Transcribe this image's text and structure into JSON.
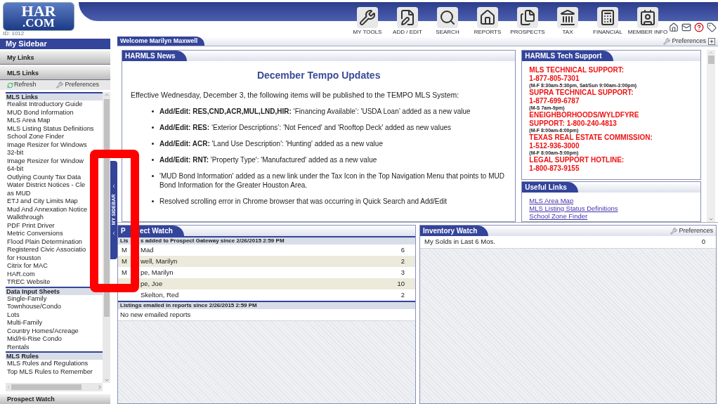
{
  "header": {
    "logo_top": "HAR",
    "logo_bottom": ".COM",
    "id_text": "ID: 1012",
    "nav": [
      {
        "label": "MY TOOLS"
      },
      {
        "label": "ADD / EDIT"
      },
      {
        "label": "SEARCH"
      },
      {
        "label": "REPORTS"
      },
      {
        "label": "PROSPECTS"
      },
      {
        "label": "TAX"
      },
      {
        "label": "FINANCIAL"
      },
      {
        "label": "MEMBER INFO"
      }
    ]
  },
  "sidebar": {
    "title": "My Sidebar",
    "sections": [
      "My Links",
      "MLS Links"
    ],
    "refresh": "Refresh",
    "preferences": "Preferences",
    "items": [
      {
        "kind": "heading",
        "text": "MLS Links"
      },
      {
        "kind": "link",
        "text": "Realist Introductory Guide"
      },
      {
        "kind": "link",
        "text": "MUD Bond Information"
      },
      {
        "kind": "link",
        "text": "MLS Area Map"
      },
      {
        "kind": "link",
        "text": "MLS Listing Status Definitions"
      },
      {
        "kind": "link",
        "text": "School Zone Finder"
      },
      {
        "kind": "link",
        "text": "Image Resizer for Windows"
      },
      {
        "kind": "link",
        "text": "32-bit"
      },
      {
        "kind": "link",
        "text": "Image Resizer for Window"
      },
      {
        "kind": "link",
        "text": "64-bit"
      },
      {
        "kind": "link",
        "text": "Outlying County Tax Data"
      },
      {
        "kind": "link",
        "text": "Water District Notices - Cle"
      },
      {
        "kind": "link",
        "text": "as MUD"
      },
      {
        "kind": "link",
        "text": "ETJ and City Limits Map"
      },
      {
        "kind": "link",
        "text": "Mud And Annexation Notice"
      },
      {
        "kind": "link",
        "text": "Walkthrough"
      },
      {
        "kind": "link",
        "text": "PDF Print Driver"
      },
      {
        "kind": "link",
        "text": "Metric Conversions"
      },
      {
        "kind": "link",
        "text": "Flood Plain Determination"
      },
      {
        "kind": "link",
        "text": "Registered Civic Associatio"
      },
      {
        "kind": "link",
        "text": "for Houston"
      },
      {
        "kind": "link",
        "text": "Citrix for MAC"
      },
      {
        "kind": "link",
        "text": "HAR.com"
      },
      {
        "kind": "link",
        "text": "TREC Website"
      },
      {
        "kind": "heading",
        "text": "Data Input Sheets"
      },
      {
        "kind": "link",
        "text": "Single-Family"
      },
      {
        "kind": "link",
        "text": "Townhouse/Condo"
      },
      {
        "kind": "link",
        "text": "Lots"
      },
      {
        "kind": "link",
        "text": "Multi-Family"
      },
      {
        "kind": "link",
        "text": "Country Homes/Acreage"
      },
      {
        "kind": "link",
        "text": "Mid/Hi-Rise Condo"
      },
      {
        "kind": "link",
        "text": "Rentals"
      },
      {
        "kind": "heading",
        "text": "MLS Rules"
      },
      {
        "kind": "link",
        "text": "MLS Rules and Regulations"
      },
      {
        "kind": "link",
        "text": "Top MLS Rules to Remember"
      }
    ],
    "footer": "Prospect Watch"
  },
  "side_tab": "MY SIDEBAR",
  "welcome": "Welcome Marilyn Maxwell",
  "preferences": "Preferences",
  "news": {
    "title": "HARMLS News",
    "heading": "December Tempo Updates",
    "intro": "Effective Wednesday, December 3, the following items will be published to the TEMPO MLS System:",
    "bullets": [
      "**Add/Edit: RES,CND,ACR,MUL,LND,HIR:** ‘Financing Available’: 'USDA Loan’ added as a new value",
      "**Add/Edit: RES:** ‘Exterior Descriptions’: 'Not Fenced' and 'Rooftop Deck' added as new values",
      "**Add/Edit: ACR:** 'Land Use Description': 'Hunting' added as a new value",
      "**Add/Edit: RNT:** 'Property Type': 'Manufactured' added as a new value",
      "'MUD Bond Information' added as a new link under the Tax Icon in the Top Navigation Menu that points to MUD Bond Information for the Greater Houston Area.",
      "Resolved scrolling error in Chrome browser that was occurring in Quick Search and Add/Edit"
    ]
  },
  "tech_support": {
    "title": "HARMLS Tech Support",
    "lines": [
      {
        "kind": "contact",
        "text": "MLS TECHNICAL SUPPORT:"
      },
      {
        "kind": "contact",
        "text": "1-877-805-7301"
      },
      {
        "kind": "hours",
        "text": "(M-F 8:30am-5:30pm, Sat/Sun 9:00am-3:00pm)"
      },
      {
        "kind": "contact",
        "text": "SUPRA TECHNICAL SUPPORT:"
      },
      {
        "kind": "contact",
        "text": "1-877-699-6787"
      },
      {
        "kind": "hours",
        "text": "(M-S 7am-9pm)"
      },
      {
        "kind": "contact",
        "text": "ENEIGHBORHOODS/WYLDFYRE"
      },
      {
        "kind": "contact",
        "text": "SUPPORT: 1-800-240-4813"
      },
      {
        "kind": "hours",
        "text": "(M-F 8:00am-6:00pm)"
      },
      {
        "kind": "contact",
        "text": "TEXAS REAL ESTATE COMMISSION:"
      },
      {
        "kind": "contact",
        "text": "1-512-936-3000"
      },
      {
        "kind": "hours",
        "text": "(M-F 8:00am-5:00pm)"
      },
      {
        "kind": "contact",
        "text": "LEGAL SUPPORT HOTLINE:"
      },
      {
        "kind": "contact",
        "text": "1-800-873-9155"
      }
    ]
  },
  "useful_links": {
    "title": "Useful Links",
    "links": [
      "MLS Area Map",
      "MLS Listing Status Definitions",
      "School Zone Finder"
    ]
  },
  "prospect_watch": {
    "title_lead": "P",
    "title_rest": "ect Watch",
    "added_lead": "Lis",
    "added_rest": "s added to Prospect Gateway since 2/26/2015 2:59 PM",
    "rows": [
      {
        "lead": "M",
        "name": "Mad",
        "count": "6"
      },
      {
        "lead": "M",
        "name": "well, Marilyn",
        "count": "2"
      },
      {
        "lead": "M",
        "name": "pe, Marilyn",
        "count": "3"
      },
      {
        "lead": "",
        "name": "pe, Joe",
        "count": "10"
      },
      {
        "lead": "",
        "name": "Skelton, Red",
        "count": "2"
      }
    ],
    "emailed_heading": "Listings emailed in reports since 2/26/2015 2:59 PM",
    "emailed_empty": "No new emailed reports"
  },
  "inventory_watch": {
    "title": "Inventory Watch",
    "preferences": "Preferences",
    "rows": [
      {
        "label": "My Solds in Last 6 Mos.",
        "count": "0"
      }
    ]
  }
}
